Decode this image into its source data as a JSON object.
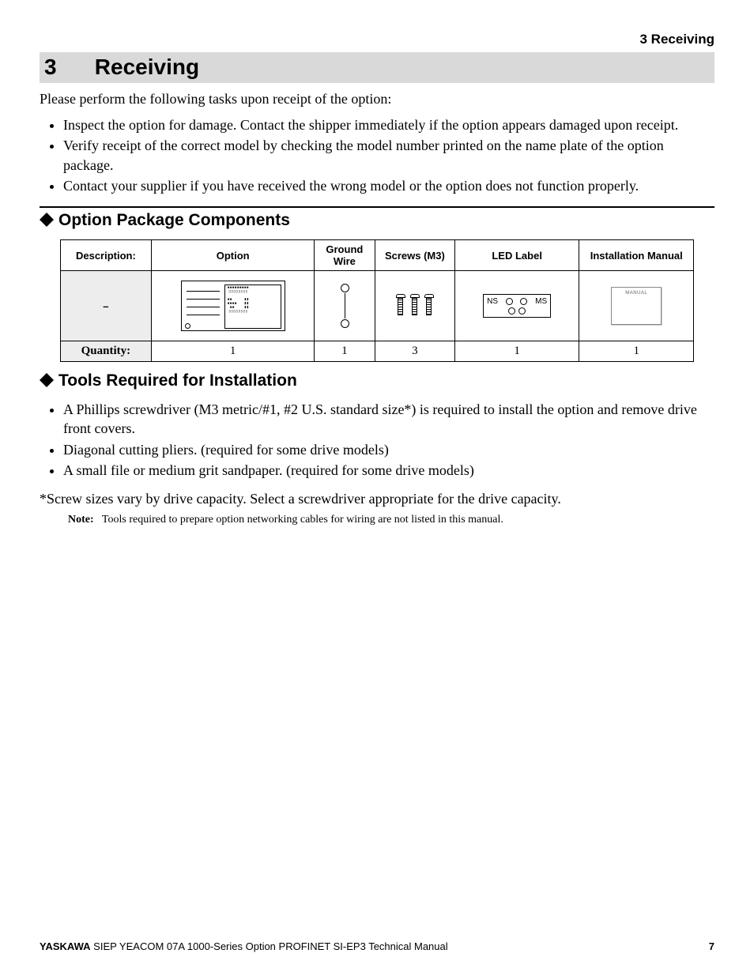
{
  "running_head": "3  Receiving",
  "chapter": {
    "number": "3",
    "title": "Receiving"
  },
  "intro": "Please perform the following tasks upon receipt of the option:",
  "receipt_tasks": [
    "Inspect the option for damage. Contact the shipper immediately if the option appears damaged upon receipt.",
    "Verify receipt of the correct model by checking the model number printed on the name plate of the option package.",
    "Contact your supplier if you have received the wrong model or the option does not function properly."
  ],
  "section_components": {
    "heading": "Option Package Components",
    "table": {
      "row_labels": {
        "description": "Description:",
        "quantity": "Quantity:"
      },
      "columns": [
        "Option",
        "Ground Wire",
        "Screws (M3)",
        "LED Label",
        "Installation Manual"
      ],
      "description_row_placeholder": "–",
      "led_label_text": {
        "ns": "NS",
        "ms": "MS"
      },
      "manual_text": "MANUAL",
      "quantities": [
        "1",
        "1",
        "3",
        "1",
        "1"
      ]
    }
  },
  "section_tools": {
    "heading": "Tools Required for Installation",
    "items": [
      "A Phillips screwdriver (M3 metric/#1, #2 U.S. standard size*) is required to install the option and remove drive front covers.",
      "Diagonal cutting pliers. (required for some drive models)",
      "A small file or medium grit sandpaper. (required for some drive models)"
    ],
    "footnote": "*Screw sizes vary by drive capacity. Select a screwdriver appropriate for the drive capacity.",
    "note_label": "Note:",
    "note_text": "Tools required to prepare option networking cables for wiring are not listed in this manual."
  },
  "footer": {
    "brand": "YASKAWA",
    "doc": " SIEP YEACOM 07A 1000-Series Option PROFINET SI-EP3 Technical Manual",
    "page": "7"
  }
}
